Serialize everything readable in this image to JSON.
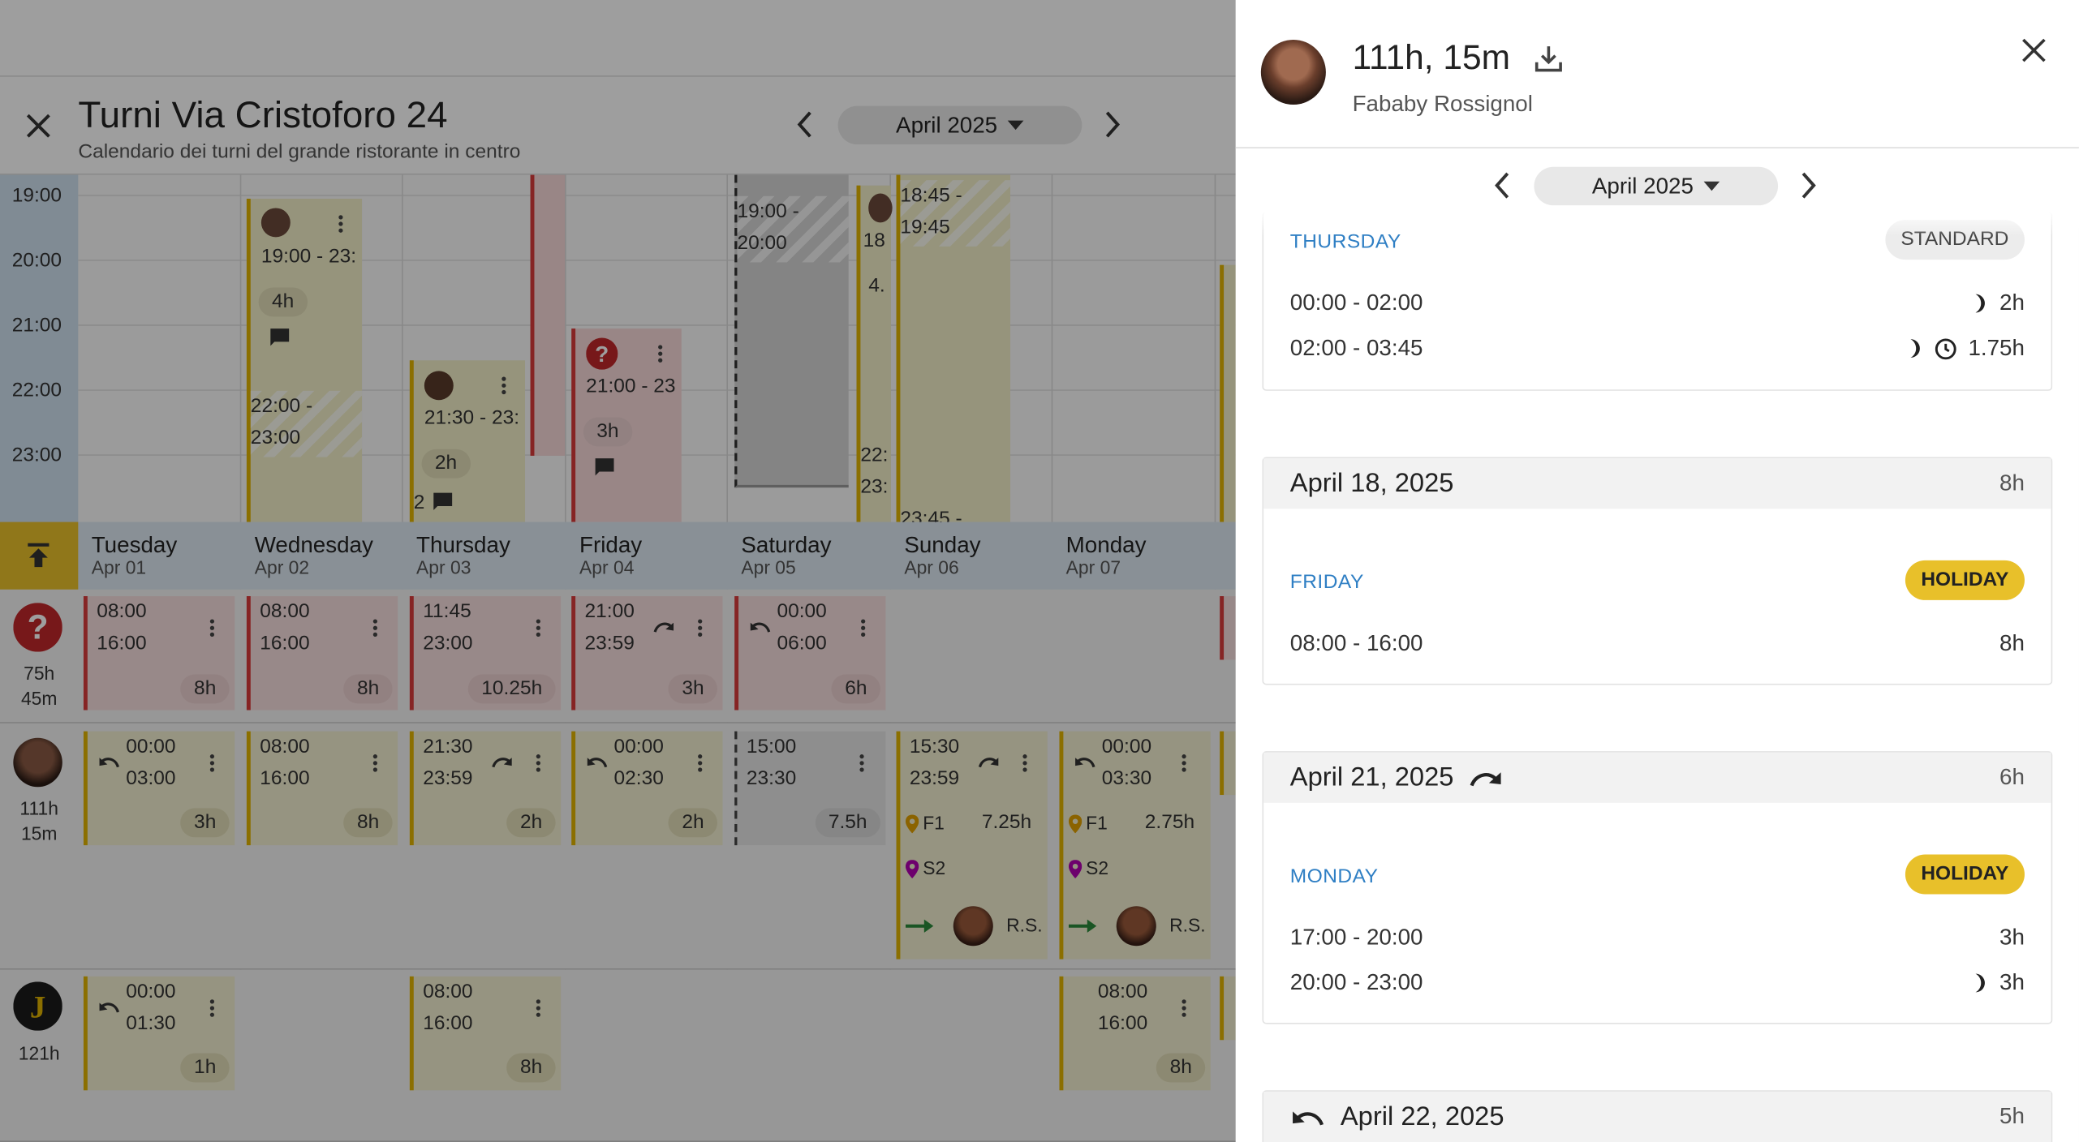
{
  "header": {
    "title": "Turni Via Cristoforo 24",
    "subtitle": "Calendario dei turni del grande ristorante in centro",
    "month": "April 2025"
  },
  "hours": [
    "19:00",
    "20:00",
    "21:00",
    "22:00",
    "23:00"
  ],
  "days": [
    {
      "name": "Tuesday",
      "date": "Apr 01"
    },
    {
      "name": "Wednesday",
      "date": "Apr 02"
    },
    {
      "name": "Thursday",
      "date": "Apr 03"
    },
    {
      "name": "Friday",
      "date": "Apr 04"
    },
    {
      "name": "Saturday",
      "date": "Apr 05"
    },
    {
      "name": "Sunday",
      "date": "Apr 06"
    },
    {
      "name": "Monday",
      "date": "Apr 07"
    }
  ],
  "timeline": {
    "wed_time": "19:00 - 23:",
    "wed_dur": "4h",
    "wed_hatch": "22:00 -\n23:00",
    "thu_time": "21:30 - 23:",
    "thu_dur": "2h",
    "thu_count": "2",
    "fri_time": "21:00 - 23",
    "fri_dur": "3h",
    "sat_time": "19:00 -\n20:00",
    "sun_partial": "18",
    "sun_dur_partial": "4.",
    "sun_22": "22:",
    "sun_23": "23:",
    "sun2_time": "18:45 -\n19:45",
    "sun2_bottom": "23:45 -"
  },
  "rows": [
    {
      "label": "75h\n45m",
      "shifts": [
        {
          "start": "08:00",
          "end": "16:00",
          "dur": "8h"
        },
        {
          "start": "08:00",
          "end": "16:00",
          "dur": "8h"
        },
        {
          "start": "11:45",
          "end": "23:00",
          "dur": "10.25h"
        },
        {
          "start": "21:00",
          "end": "23:59",
          "dur": "3h"
        },
        {
          "start": "00:00",
          "end": "06:00",
          "dur": "6h"
        }
      ]
    },
    {
      "label": "111h\n15m",
      "shifts": [
        {
          "start": "00:00",
          "end": "03:00",
          "dur": "3h"
        },
        {
          "start": "08:00",
          "end": "16:00",
          "dur": "8h"
        },
        {
          "start": "21:30",
          "end": "23:59",
          "dur": "2h"
        },
        {
          "start": "00:00",
          "end": "02:30",
          "dur": "2h"
        },
        {
          "start": "15:00",
          "end": "23:30",
          "dur": "7.5h"
        },
        {
          "start": "15:30",
          "end": "23:59",
          "dur": "7.25h",
          "loc1": "F1",
          "loc2": "S2",
          "initials": "R.S."
        },
        {
          "start": "00:00",
          "end": "03:30",
          "dur": "2.75h",
          "loc1": "F1",
          "loc2": "S2",
          "initials": "R.S."
        }
      ]
    },
    {
      "label": "121h",
      "shifts": [
        {
          "start": "00:00",
          "end": "01:30",
          "dur": "1h"
        },
        {
          "start": "08:00",
          "end": "16:00",
          "dur": "8h"
        },
        {
          "start": "08:00",
          "end": "16:00",
          "dur": "8h"
        }
      ]
    }
  ],
  "panel": {
    "total": "111h, 15m",
    "name": "Fababy Rossignol",
    "month": "April 2025",
    "card0": {
      "weekday": "THURSDAY",
      "badge": "STANDARD",
      "entries": [
        {
          "range": "00:00 - 02:00",
          "hours": "2h"
        },
        {
          "range": "02:00 - 03:45",
          "hours": "1.75h"
        }
      ]
    },
    "card1": {
      "date": "April 18, 2025",
      "total": "8h",
      "weekday": "FRIDAY",
      "badge": "HOLIDAY",
      "entries": [
        {
          "range": "08:00 - 16:00",
          "hours": "8h"
        }
      ]
    },
    "card2": {
      "date": "April 21, 2025",
      "total": "6h",
      "weekday": "MONDAY",
      "badge": "HOLIDAY",
      "entries": [
        {
          "range": "17:00 - 20:00",
          "hours": "3h"
        },
        {
          "range": "20:00 - 23:00",
          "hours": "3h"
        }
      ]
    },
    "card3": {
      "date": "April 22, 2025",
      "total": "5h"
    }
  },
  "colors": {
    "accent_yellow": "#e9c02a",
    "shift_red": "#d93a3a",
    "weekday_blue": "#2f7fc4"
  }
}
